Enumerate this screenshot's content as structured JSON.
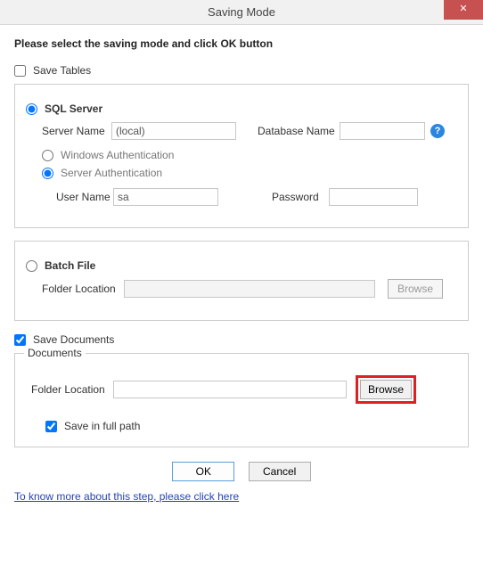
{
  "title": "Saving Mode",
  "heading": "Please select the saving mode and click OK button",
  "saveTables": {
    "label": "Save Tables",
    "checked": false
  },
  "sqlServer": {
    "radioLabel": "SQL Server",
    "checked": true,
    "serverName": {
      "label": "Server Name",
      "value": "(local)"
    },
    "databaseName": {
      "label": "Database Name",
      "value": ""
    },
    "windowsAuth": {
      "label": "Windows Authentication",
      "checked": false
    },
    "serverAuth": {
      "label": "Server Authentication",
      "checked": true
    },
    "userName": {
      "label": "User Name",
      "value": "sa"
    },
    "password": {
      "label": "Password",
      "value": ""
    }
  },
  "batchFile": {
    "radioLabel": "Batch File",
    "checked": false,
    "folderLocation": {
      "label": "Folder Location",
      "value": ""
    },
    "browseLabel": "Browse"
  },
  "saveDocuments": {
    "label": "Save Documents",
    "checked": true
  },
  "documents": {
    "legend": "Documents",
    "folderLocation": {
      "label": "Folder Location",
      "value": ""
    },
    "browseLabel": "Browse",
    "saveFullPath": {
      "label": "Save in full path",
      "checked": true
    }
  },
  "buttons": {
    "ok": "OK",
    "cancel": "Cancel"
  },
  "helpLink": "To know more about this step, please click here"
}
